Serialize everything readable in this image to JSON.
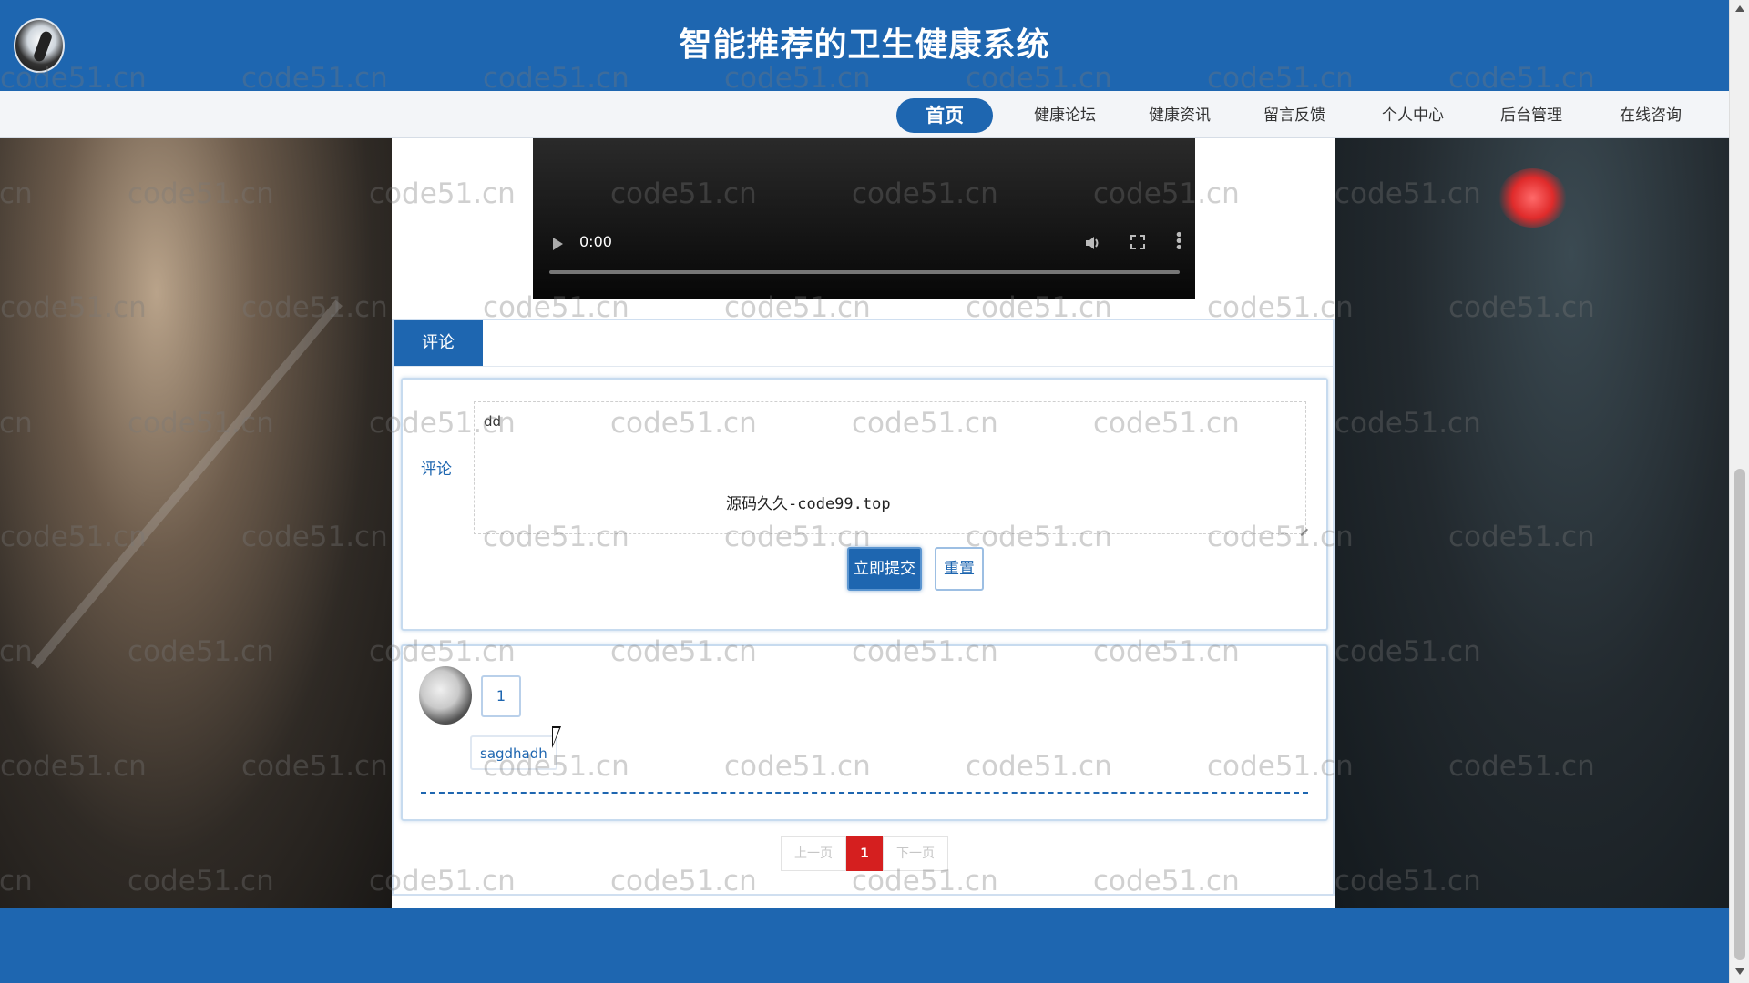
{
  "header": {
    "title": "智能推荐的卫生健康系统"
  },
  "nav": {
    "items": [
      {
        "label": "首页",
        "active": true
      },
      {
        "label": "健康论坛"
      },
      {
        "label": "健康资讯"
      },
      {
        "label": "留言反馈"
      },
      {
        "label": "个人中心"
      },
      {
        "label": "后台管理"
      },
      {
        "label": "在线咨询"
      }
    ]
  },
  "video": {
    "time": "0:00"
  },
  "comments": {
    "tab_label": "评论",
    "form_label": "评论",
    "textarea_value": "dd",
    "overlay_text": "源码久久-code99.top",
    "submit_label": "立即提交",
    "reset_label": "重置",
    "list": [
      {
        "content": "1",
        "username": "sagdhadh"
      }
    ]
  },
  "pagination": {
    "prev_label": "上一页",
    "current": "1",
    "next_label": "下一页"
  },
  "watermark": {
    "text": "code51.cn"
  },
  "colors": {
    "primary": "#1e66b0",
    "page_active": "#d51f1f"
  }
}
